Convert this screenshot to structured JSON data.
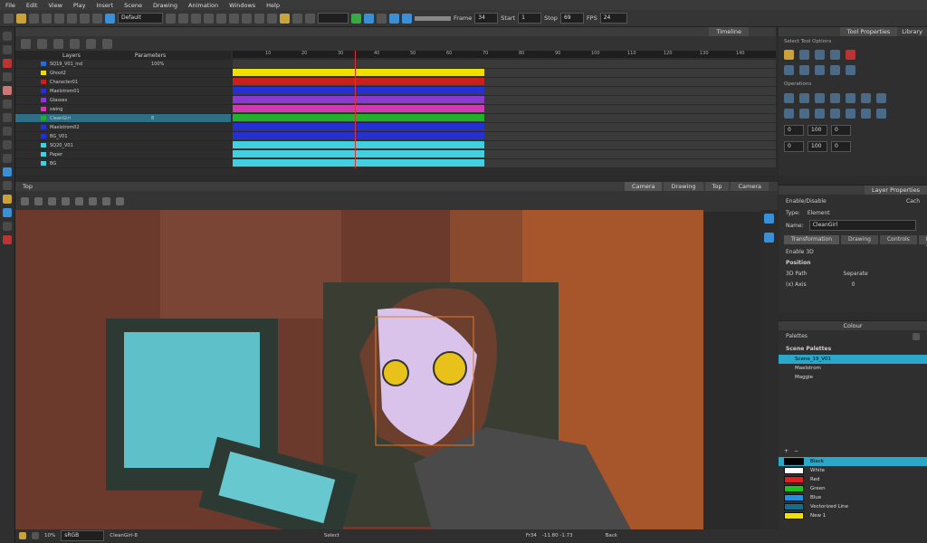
{
  "menu": [
    "File",
    "Edit",
    "View",
    "Play",
    "Insert",
    "Scene",
    "Drawing",
    "Animation",
    "Windows",
    "Help"
  ],
  "toolbar": {
    "workspace": "Default",
    "frame_label": "Frame",
    "frame_value": "34",
    "start_label": "Start",
    "start_value": "1",
    "stop_label": "Stop",
    "stop_value": "69",
    "fps_label": "FPS",
    "fps_value": "24"
  },
  "timeline": {
    "title": "Timeline",
    "col_layers": "Layers",
    "col_params": "Parameters",
    "ruler_ticks": [
      "10",
      "20",
      "30",
      "40",
      "50",
      "60",
      "70",
      "80",
      "90",
      "100",
      "110",
      "120",
      "130",
      "140"
    ],
    "layers": [
      {
        "name": "SQ19_V01_ind",
        "color": "#2a6bd1",
        "value": "100%"
      },
      {
        "name": "Ghost2",
        "color": "#f0e000",
        "value": ""
      },
      {
        "name": "Character01",
        "color": "#c8201a",
        "value": ""
      },
      {
        "name": "Maelstrom01",
        "color": "#2430d0",
        "value": ""
      },
      {
        "name": "Glasses",
        "color": "#8a3ad0",
        "value": ""
      },
      {
        "name": "swing",
        "color": "#d03ab0",
        "value": ""
      },
      {
        "name": "CleanGirl",
        "color": "#22b02a",
        "value": "8"
      },
      {
        "name": "Maelstrom02",
        "color": "#2430d0",
        "value": ""
      },
      {
        "name": "BG_V01",
        "color": "#2430d0",
        "value": ""
      },
      {
        "name": "SQ20_V01",
        "color": "#40d0e0",
        "value": ""
      },
      {
        "name": "Paper",
        "color": "#40d0e0",
        "value": ""
      },
      {
        "name": "BG",
        "color": "#40d0e0",
        "value": ""
      }
    ]
  },
  "tool_properties": {
    "tab1": "Tool Properties",
    "tab2": "Library",
    "select_options": "Select Tool Options",
    "operations": "Operations",
    "fields": [
      "0",
      "100",
      "0",
      "0",
      "100",
      "0"
    ]
  },
  "layer_properties": {
    "title": "Layer Properties",
    "enable": "Enable/Disable",
    "cache": "Cach",
    "type_label": "Type:",
    "type_value": "Element",
    "name_label": "Name:",
    "name_value": "CleanGirl",
    "tabs": [
      "Transformation",
      "Drawing",
      "Controls",
      "Line Thi"
    ],
    "enable3d": "Enable 3D",
    "position": "Position",
    "path3d": "3D Path",
    "separate": "Separate",
    "xaxis": "(x) Axis",
    "xaxis_value": "0"
  },
  "colour": {
    "title": "Colour",
    "palettes_label": "Palettes",
    "scene_palettes": "Scene Palettes",
    "palettes": [
      "Scene_19_V01",
      "Maelstrom",
      "Maggie"
    ],
    "swatches": [
      {
        "name": "Black",
        "hex": "#000000"
      },
      {
        "name": "White",
        "hex": "#ffffff"
      },
      {
        "name": "Red",
        "hex": "#e02020"
      },
      {
        "name": "Green",
        "hex": "#20c020"
      },
      {
        "name": "Blue",
        "hex": "#2090e0"
      },
      {
        "name": "Vectorized Line",
        "hex": "#1a6b8a"
      },
      {
        "name": "New 1",
        "hex": "#f0e000"
      }
    ]
  },
  "viewport": {
    "title": "Top",
    "tabs": [
      "Camera",
      "Drawing",
      "Top",
      "Camera"
    ],
    "zoom": "10%",
    "colorspace": "sRGB",
    "layer": "CleanGirl-8",
    "mode": "Select",
    "frame": "Fr34",
    "coords": "-11.80 -1.73",
    "side": "Back"
  }
}
